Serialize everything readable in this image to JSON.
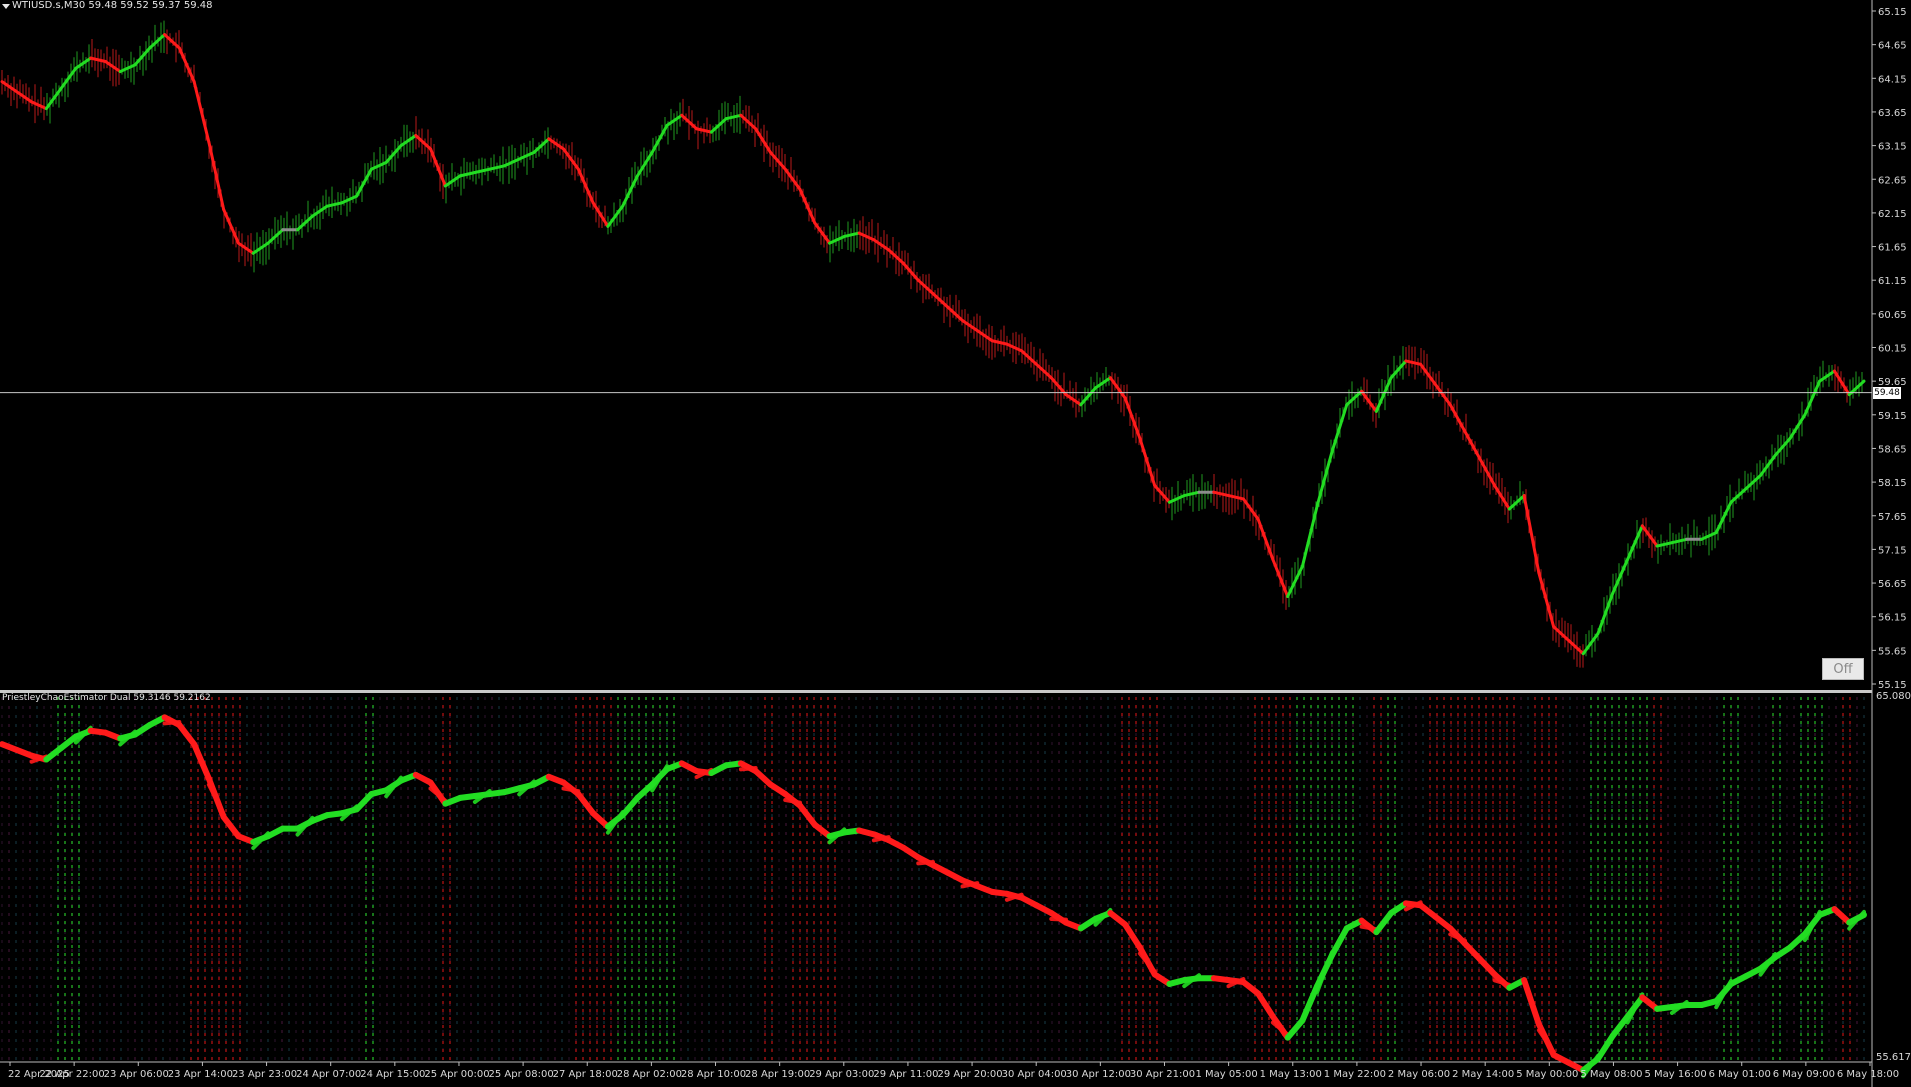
{
  "window": {
    "symbol_label": "WTIUSD.s,M30",
    "ohlc_text": "59.48 59.52 59.37 59.48",
    "current_price": "59.48",
    "off_button": "Off"
  },
  "indicator": {
    "label": "PriestleyChaoEstimator Dual 59.3146 59.2162",
    "top_value": "65.0803",
    "bottom_value": "55.6175"
  },
  "colors": {
    "background": "#000000",
    "up": "#22dd22",
    "down": "#ff1a1a",
    "neutral": "#8c8c8c",
    "price_line": "#c8c8c8",
    "axis_text": "#d8d8d8"
  },
  "chart_data": [
    {
      "type": "line",
      "title": "WTIUSD.s,M30",
      "price_axis_ticks": [
        "65.15",
        "64.65",
        "64.15",
        "63.65",
        "63.15",
        "62.65",
        "62.15",
        "61.65",
        "61.15",
        "60.65",
        "60.15",
        "59.65",
        "59.15",
        "58.65",
        "58.15",
        "57.65",
        "57.15",
        "56.65",
        "56.15",
        "55.65",
        "55.15"
      ],
      "time_axis_labels": [
        "22 Apr 2025",
        "22 Apr 22:00",
        "23 Apr 06:00",
        "23 Apr 14:00",
        "23 Apr 23:00",
        "24 Apr 07:00",
        "24 Apr 15:00",
        "25 Apr 00:00",
        "25 Apr 08:00",
        "27 Apr 18:00",
        "28 Apr 02:00",
        "28 Apr 10:00",
        "28 Apr 19:00",
        "29 Apr 03:00",
        "29 Apr 11:00",
        "29 Apr 20:00",
        "30 Apr 04:00",
        "30 Apr 12:00",
        "30 Apr 21:00",
        "1 May 05:00",
        "1 May 13:00",
        "1 May 22:00",
        "2 May 06:00",
        "2 May 14:00",
        "5 May 00:00",
        "5 May 08:00",
        "5 May 16:00",
        "6 May 01:00",
        "6 May 09:00",
        "6 May 18:00"
      ],
      "ylim": [
        55.15,
        65.15
      ],
      "current_price": 59.48,
      "series": [
        {
          "color_key": "smoothed",
          "points": [
            [
              0,
              64.1
            ],
            [
              1,
              63.95
            ],
            [
              2,
              63.8
            ],
            [
              3,
              63.7
            ],
            [
              4,
              64.0
            ],
            [
              5,
              64.3
            ],
            [
              6,
              64.45
            ],
            [
              7,
              64.4
            ],
            [
              8,
              64.25
            ],
            [
              9,
              64.35
            ],
            [
              10,
              64.6
            ],
            [
              11,
              64.8
            ],
            [
              12,
              64.6
            ],
            [
              13,
              64.1
            ],
            [
              14,
              63.2
            ],
            [
              15,
              62.2
            ],
            [
              16,
              61.7
            ],
            [
              17,
              61.55
            ],
            [
              18,
              61.7
            ],
            [
              19,
              61.9
            ],
            [
              20,
              61.9
            ],
            [
              21,
              62.1
            ],
            [
              22,
              62.25
            ],
            [
              23,
              62.3
            ],
            [
              24,
              62.4
            ],
            [
              25,
              62.8
            ],
            [
              26,
              62.9
            ],
            [
              27,
              63.15
            ],
            [
              28,
              63.3
            ],
            [
              29,
              63.1
            ],
            [
              30,
              62.55
            ],
            [
              31,
              62.7
            ],
            [
              32,
              62.75
            ],
            [
              33,
              62.8
            ],
            [
              34,
              62.85
            ],
            [
              35,
              62.95
            ],
            [
              36,
              63.05
            ],
            [
              37,
              63.25
            ],
            [
              38,
              63.1
            ],
            [
              39,
              62.8
            ],
            [
              40,
              62.3
            ],
            [
              41,
              61.95
            ],
            [
              42,
              62.25
            ],
            [
              43,
              62.7
            ],
            [
              44,
              63.05
            ],
            [
              45,
              63.45
            ],
            [
              46,
              63.6
            ],
            [
              47,
              63.4
            ],
            [
              48,
              63.35
            ],
            [
              49,
              63.55
            ],
            [
              50,
              63.6
            ],
            [
              51,
              63.4
            ],
            [
              52,
              63.05
            ],
            [
              53,
              62.8
            ],
            [
              54,
              62.5
            ],
            [
              55,
              62.0
            ],
            [
              56,
              61.7
            ],
            [
              57,
              61.8
            ],
            [
              58,
              61.85
            ],
            [
              59,
              61.75
            ],
            [
              60,
              61.6
            ],
            [
              61,
              61.4
            ],
            [
              62,
              61.15
            ],
            [
              63,
              60.95
            ],
            [
              64,
              60.75
            ],
            [
              65,
              60.55
            ],
            [
              66,
              60.4
            ],
            [
              67,
              60.25
            ],
            [
              68,
              60.2
            ],
            [
              69,
              60.1
            ],
            [
              70,
              59.9
            ],
            [
              71,
              59.7
            ],
            [
              72,
              59.45
            ],
            [
              73,
              59.3
            ],
            [
              74,
              59.55
            ],
            [
              75,
              59.7
            ],
            [
              76,
              59.4
            ],
            [
              77,
              58.8
            ],
            [
              78,
              58.1
            ],
            [
              79,
              57.85
            ],
            [
              80,
              57.95
            ],
            [
              81,
              58.0
            ],
            [
              82,
              58.0
            ],
            [
              83,
              57.95
            ],
            [
              84,
              57.9
            ],
            [
              85,
              57.6
            ],
            [
              86,
              57.0
            ],
            [
              87,
              56.45
            ],
            [
              88,
              56.9
            ],
            [
              89,
              57.8
            ],
            [
              90,
              58.6
            ],
            [
              91,
              59.3
            ],
            [
              92,
              59.5
            ],
            [
              93,
              59.2
            ],
            [
              94,
              59.7
            ],
            [
              95,
              59.95
            ],
            [
              96,
              59.9
            ],
            [
              97,
              59.6
            ],
            [
              98,
              59.3
            ],
            [
              99,
              58.9
            ],
            [
              100,
              58.5
            ],
            [
              101,
              58.1
            ],
            [
              102,
              57.75
            ],
            [
              103,
              57.95
            ],
            [
              104,
              56.8
            ],
            [
              105,
              56.0
            ],
            [
              106,
              55.8
            ],
            [
              107,
              55.6
            ],
            [
              108,
              55.9
            ],
            [
              109,
              56.5
            ],
            [
              110,
              57.0
            ],
            [
              111,
              57.5
            ],
            [
              112,
              57.2
            ],
            [
              113,
              57.25
            ],
            [
              114,
              57.3
            ],
            [
              115,
              57.3
            ],
            [
              116,
              57.4
            ],
            [
              117,
              57.85
            ],
            [
              118,
              58.05
            ],
            [
              119,
              58.25
            ],
            [
              120,
              58.55
            ],
            [
              121,
              58.8
            ],
            [
              122,
              59.15
            ],
            [
              123,
              59.65
            ],
            [
              124,
              59.8
            ],
            [
              125,
              59.45
            ],
            [
              126,
              59.65
            ]
          ]
        }
      ],
      "indicator": {
        "name": "PriestleyChaoEstimator Dual",
        "values": [
          "59.3146",
          "59.2162"
        ],
        "ylim": [
          55.6175,
          65.0803
        ]
      }
    }
  ]
}
